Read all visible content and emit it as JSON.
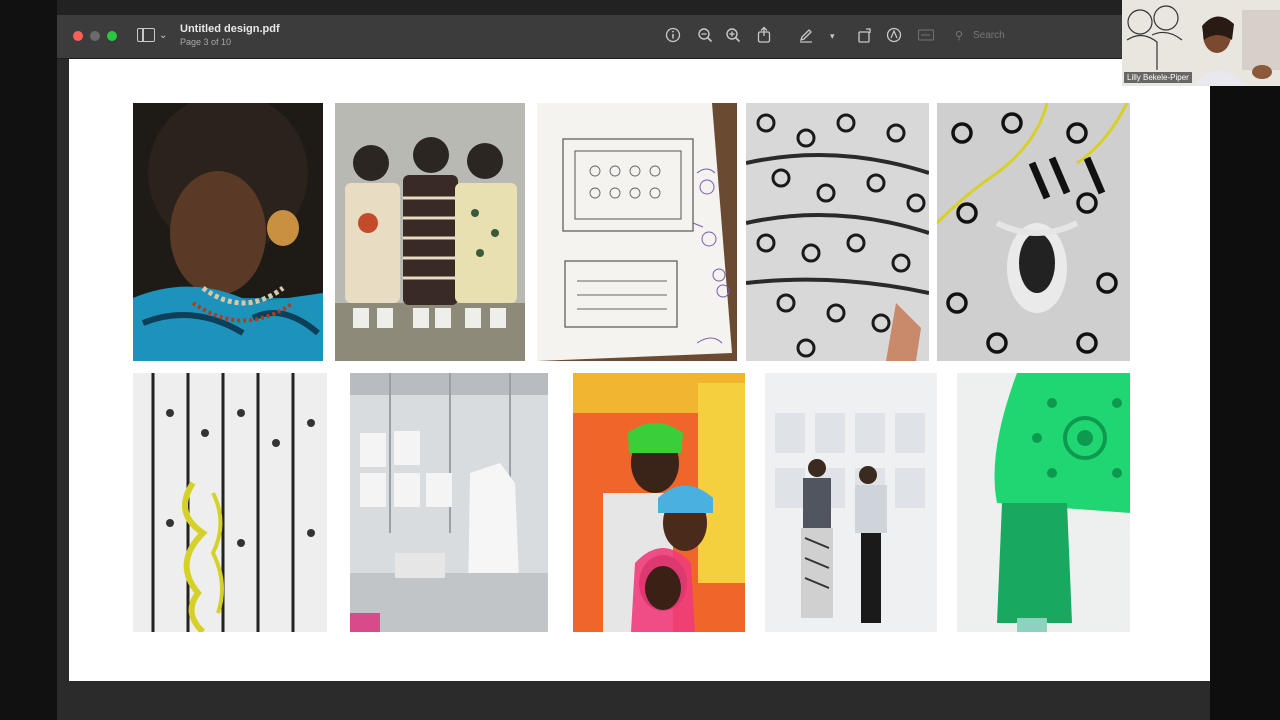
{
  "window": {
    "title": "Untitled design.pdf",
    "subtitle": "Page 3 of 10",
    "search_placeholder": "Search"
  },
  "video": {
    "participant_name": "Lilly Bekele-Piper"
  },
  "toolbar": {
    "icons": [
      "info-icon",
      "zoom-out-icon",
      "zoom-in-icon",
      "share-icon",
      "markup-pen-icon",
      "chevron-down-icon",
      "rotate-icon",
      "markup-circle-icon",
      "form-fill-icon",
      "search-icon"
    ]
  },
  "colors": {
    "titlebar": "#3c3c3c",
    "page": "#ffffff",
    "accent_green": "#22c25a",
    "accent_teal": "#1d8fb0"
  }
}
